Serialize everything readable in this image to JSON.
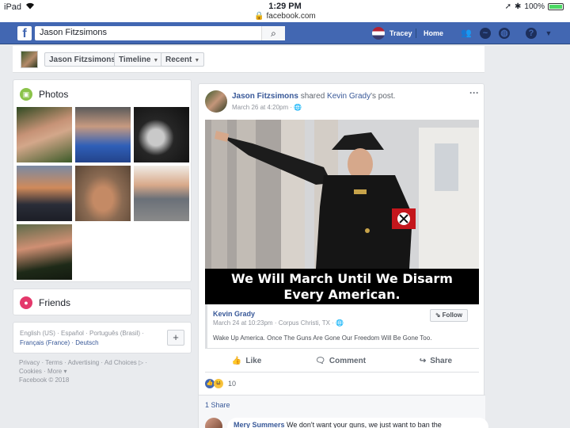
{
  "status_bar": {
    "device": "iPad",
    "time": "1:29 PM",
    "url": "facebook.com",
    "battery": "100%"
  },
  "nav": {
    "search_value": "Jason Fitzsimons",
    "user_name": "Tracey",
    "home_label": "Home"
  },
  "profile_bar": {
    "name": "Jason Fitzsimons",
    "timeline": "Timeline",
    "recent": "Recent"
  },
  "sidebar": {
    "photos_title": "Photos",
    "friends_title": "Friends",
    "languages_line1": "English (US) · Español · Português (Brasil) ·",
    "languages_line2": "Français (France) · Deutsch",
    "footer_line1": "Privacy · Terms · Advertising · Ad Choices ▷ ·",
    "footer_line2": "Cookies · More ▾",
    "footer_line3": "Facebook © 2018"
  },
  "post": {
    "author": "Jason Fitzsimons",
    "shared": "shared",
    "original_author": "Kevin Grady",
    "suffix": "'s post.",
    "time": "March 26 at 4:20pm · 🌐",
    "meme_line1": "We Will March Until We Disarm",
    "meme_line2": "Every American.",
    "shared_name": "Kevin Grady",
    "shared_time": "March 24 at 10:23pm · Corpus Christi, TX · 🌐",
    "shared_text": "Wake Up America. Once The Guns Are Gone Our Freedom Will Be Gone Too.",
    "follow": "Follow",
    "like": "Like",
    "comment": "Comment",
    "share": "Share",
    "reactions_count": "10",
    "shares": "1 Share",
    "comment_author": "Mery Summers",
    "comment_text": "We don't want your guns, we just want to ban the"
  },
  "colors": {
    "fb_blue": "#4267b2",
    "link": "#385898",
    "background": "#e9ebee"
  }
}
